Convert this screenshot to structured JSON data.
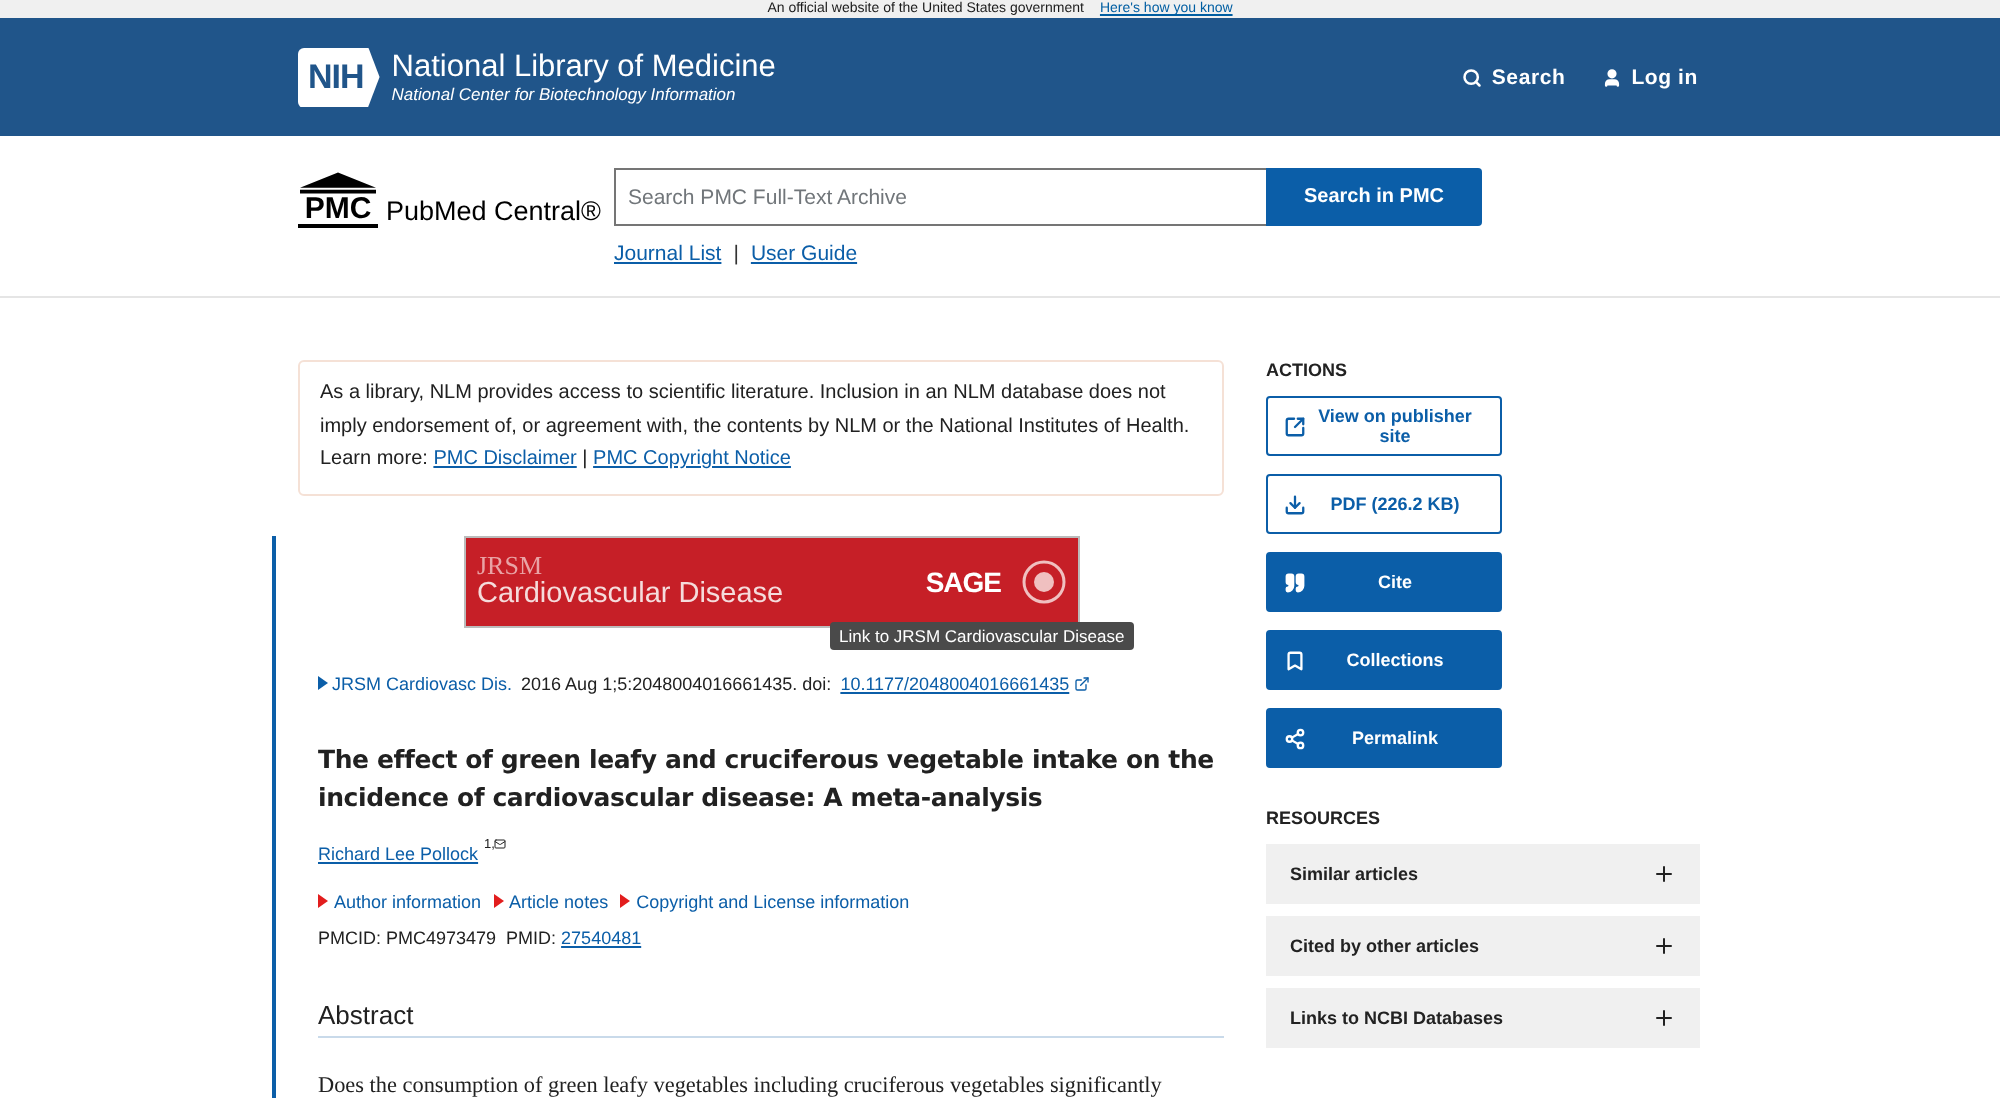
{
  "gov_banner": {
    "text": "An official website of the United States government",
    "link": "Here's how you know"
  },
  "header": {
    "logo_mark": "NIH",
    "title": "National Library of Medicine",
    "subtitle": "National Center for Biotechnology Information",
    "actions": [
      {
        "kind": "search",
        "label": "Search"
      },
      {
        "kind": "user",
        "label": "Log in"
      }
    ]
  },
  "pmc_bar": {
    "logo_mark": "PMC",
    "logo_text": "PubMed Central®",
    "search": {
      "placeholder": "Search PMC Full-Text Archive"
    },
    "search_button": "Search in PMC",
    "links": [
      "Journal List",
      "User Guide"
    ],
    "separator": "|"
  },
  "notice": {
    "text": "As a library, NLM provides access to scientific literature. Inclusion in an NLM database does not imply endorsement of, or agreement with, the contents by NLM or the National Institutes of Health.",
    "learn_more": "Learn more:",
    "links": [
      "PMC Disclaimer",
      "PMC Copyright Notice"
    ],
    "separator": "|"
  },
  "journal_banner": {
    "journal_small": "JRSM",
    "journal_name": "Cardiovascular Disease",
    "publisher": "SAGE",
    "tooltip": "Link to JRSM Cardiovascular Disease"
  },
  "citation": {
    "journal": "JRSM Cardiovasc Dis.",
    "details": " 2016 Aug 1;5:2048004016661435. doi: ",
    "doi": "10.1177/2048004016661435"
  },
  "article": {
    "title": "The effect of green leafy and cruciferous vegetable intake on the incidence of cardiovascular disease: A meta-analysis",
    "author": "Richard Lee Pollock",
    "author_mark": "1,",
    "toggles": [
      {
        "label": "Author information",
        "expanded": false
      },
      {
        "label": "Article notes",
        "expanded": false
      },
      {
        "label": "Copyright and License information",
        "expanded": false
      }
    ],
    "ids": "PMCID: PMC4973479  PMID: ",
    "pmid": "27540481",
    "abstract_heading": "Abstract",
    "abstract_text": "Does the consumption of green leafy vegetables including cruciferous vegetables significantly"
  },
  "sidebar": {
    "actions_heading": "ACTIONS",
    "actions": [
      {
        "kind": "outline",
        "label": "View on publisher site"
      },
      {
        "kind": "outline",
        "label": "PDF (226.2 KB)"
      },
      {
        "kind": "filled",
        "label": "Cite"
      },
      {
        "kind": "filled",
        "label": "Collections"
      },
      {
        "kind": "filled",
        "label": "Permalink"
      }
    ],
    "resources_heading": "RESOURCES",
    "resources": [
      {
        "label": "Similar articles",
        "expanded": false
      },
      {
        "label": "Cited by other articles",
        "expanded": false
      },
      {
        "label": "Links to NCBI Databases",
        "expanded": false
      }
    ]
  }
}
